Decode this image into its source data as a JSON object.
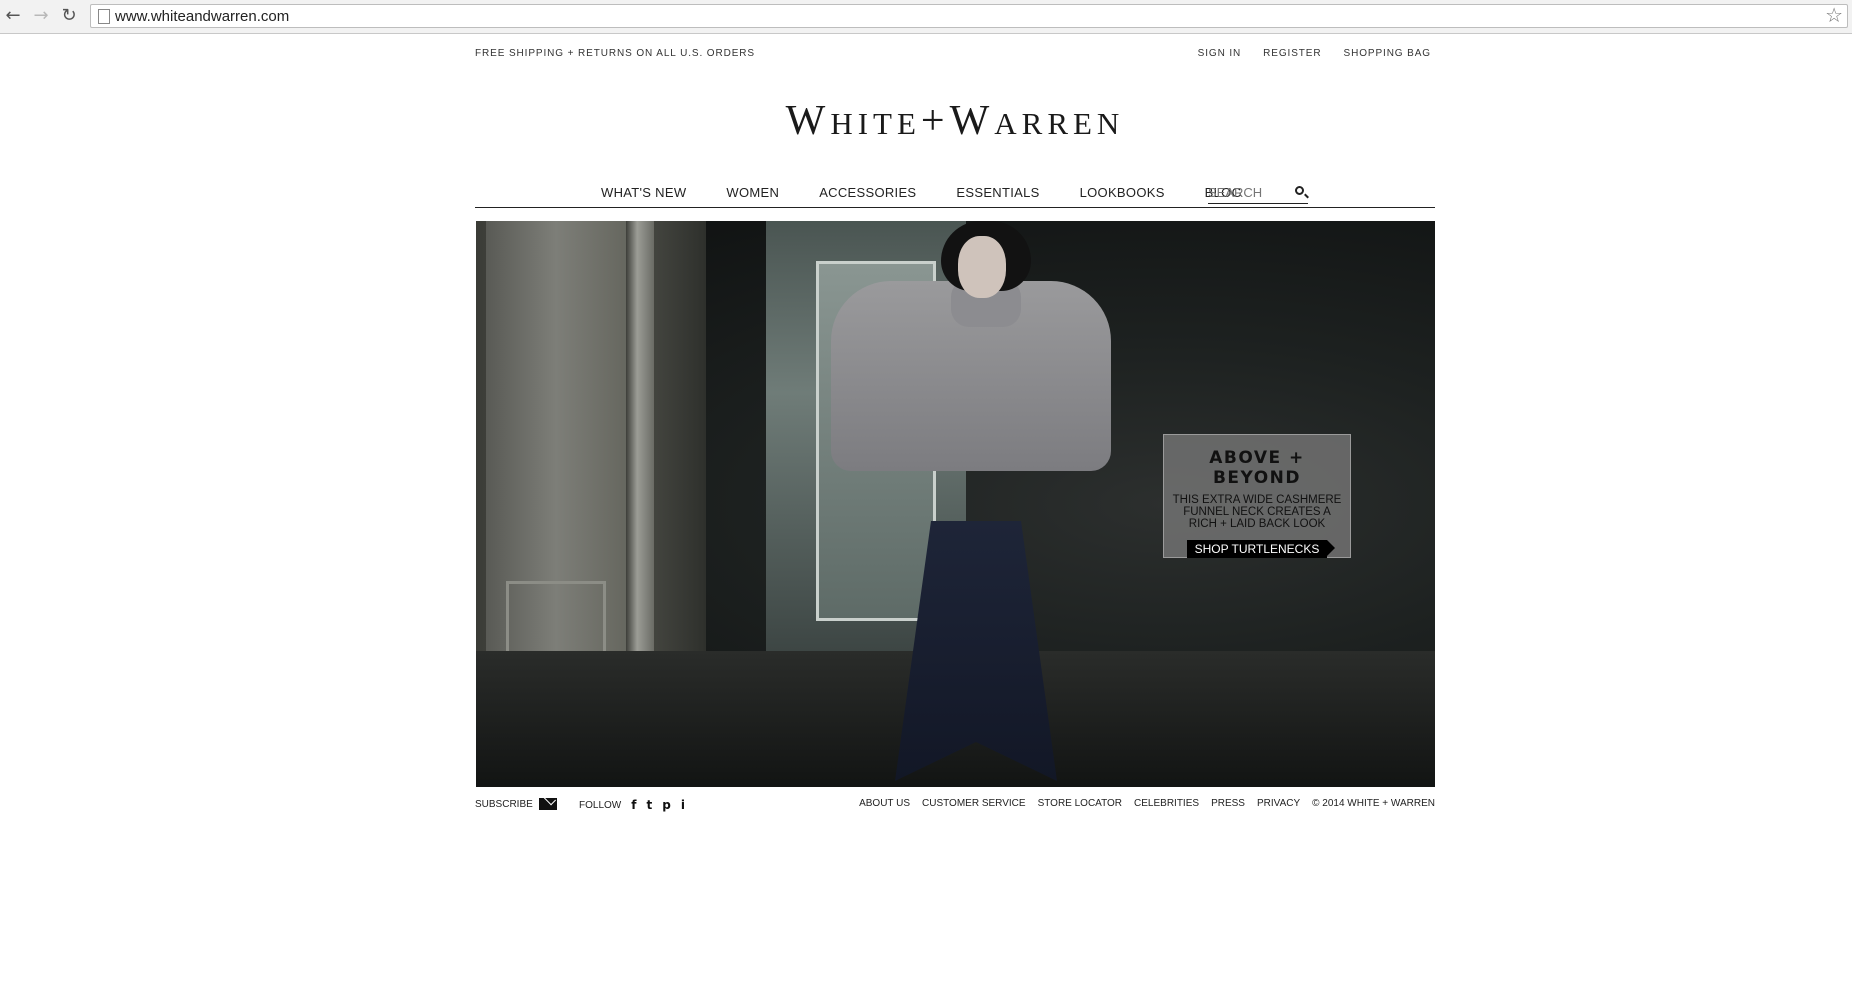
{
  "browser": {
    "back_icon": "back-arrow-icon",
    "forward_icon": "forward-arrow-icon",
    "reload_icon": "reload-icon",
    "url": "www.whiteandwarren.com",
    "bookmark_icon": "star-icon"
  },
  "header": {
    "promo": "FREE SHIPPING + RETURNS ON ALL U.S. ORDERS",
    "sign_in": "SIGN IN",
    "register": "REGISTER",
    "shopping_bag": "SHOPPING BAG"
  },
  "logo": {
    "first": "W",
    "rest1": "HITE",
    "plus": "+",
    "second": "W",
    "rest2": "ARREN"
  },
  "nav": {
    "items": [
      "WHAT'S NEW",
      "WOMEN",
      "ACCESSORIES",
      "ESSENTIALS",
      "LOOKBOOKS",
      "BLOG"
    ],
    "search_placeholder": "SEARCH"
  },
  "hero": {
    "title": "ABOVE + BEYOND",
    "text_line1": "THIS EXTRA WIDE CASHMERE",
    "text_line2": "FUNNEL NECK CREATES A",
    "text_line3": "RICH + LAID BACK LOOK",
    "cta": "SHOP TURTLENECKS"
  },
  "footer": {
    "subscribe": "SUBSCRIBE",
    "follow": "FOLLOW",
    "social": [
      "f",
      "t",
      "p",
      "i"
    ],
    "links": [
      "ABOUT US",
      "CUSTOMER SERVICE",
      "STORE LOCATOR",
      "CELEBRITIES",
      "PRESS",
      "PRIVACY"
    ],
    "copyright": "© 2014 WHITE + WARREN"
  }
}
